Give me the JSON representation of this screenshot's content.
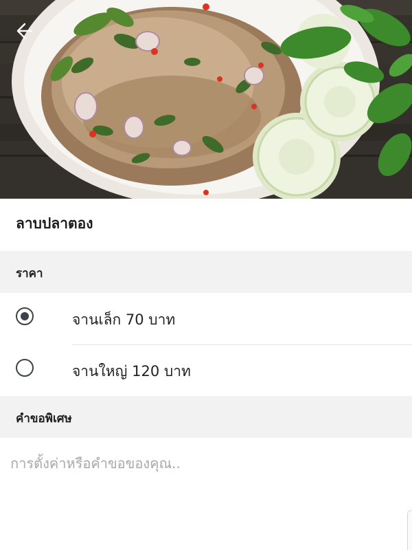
{
  "header": {
    "back_icon": "arrow-left-icon",
    "photo_subject": "food-photo"
  },
  "dish": {
    "title": "ลาบปลาตอง"
  },
  "price_section": {
    "header": "ราคา",
    "options": [
      {
        "label": "จานเล็ก 70 บาท",
        "selected": true
      },
      {
        "label": "จานใหญ่ 120 บาท",
        "selected": false
      }
    ]
  },
  "request_section": {
    "header": "คำขอพิเศษ",
    "placeholder": "การตั้งค่าหรือคำขอของคุณ..",
    "value": ""
  },
  "colors": {
    "radio": "#3b4248",
    "section_bg": "#f2f2f2",
    "placeholder": "#a8a8a8"
  }
}
